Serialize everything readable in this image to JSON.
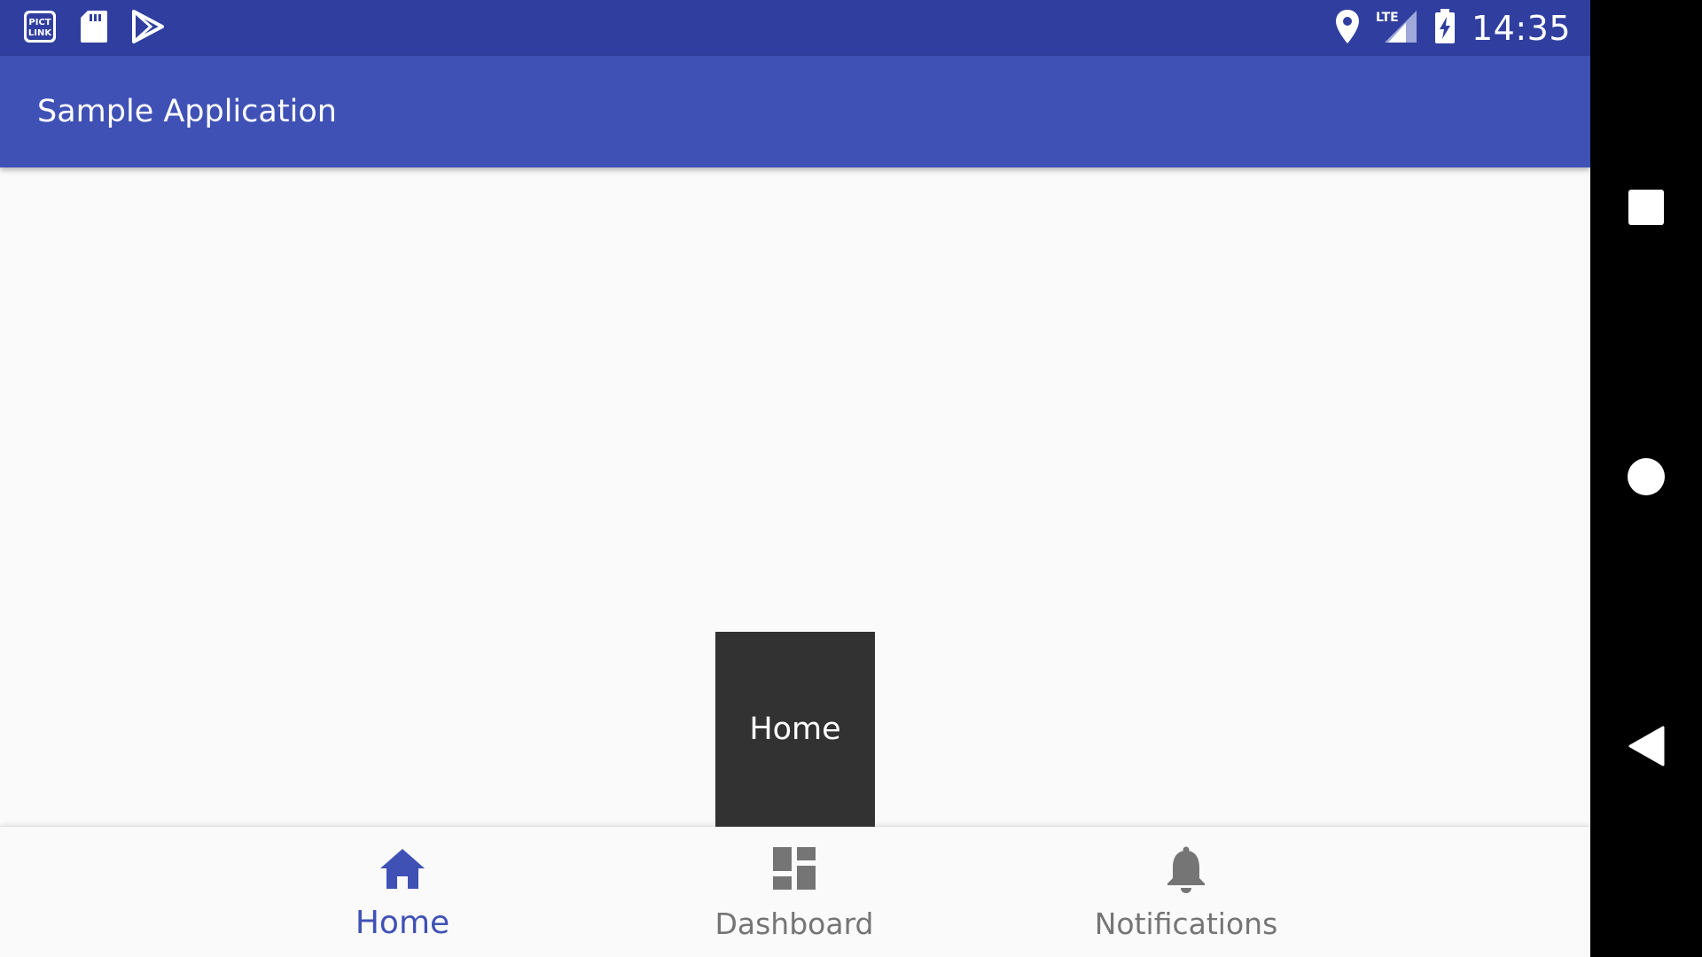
{
  "status_bar": {
    "time": "14:35",
    "left_icons": [
      "pictlink-icon",
      "sd-card-icon",
      "play-store-icon"
    ],
    "right_icons": [
      "location-icon",
      "lte-signal-icon",
      "battery-charging-icon"
    ],
    "background": "#303f9f"
  },
  "app_bar": {
    "title": "Sample Application",
    "background": "#3f51b5"
  },
  "toast": {
    "text": "Home"
  },
  "bottom_nav": {
    "items": [
      {
        "label": "Home",
        "icon": "home-icon",
        "selected": true
      },
      {
        "label": "Dashboard",
        "icon": "dashboard-icon",
        "selected": false
      },
      {
        "label": "Notifications",
        "icon": "bell-icon",
        "selected": false
      }
    ],
    "active_color": "#3f51b5",
    "inactive_color": "#757575"
  },
  "system_nav": {
    "buttons": [
      "recents-icon",
      "home-circle-icon",
      "back-icon"
    ]
  }
}
